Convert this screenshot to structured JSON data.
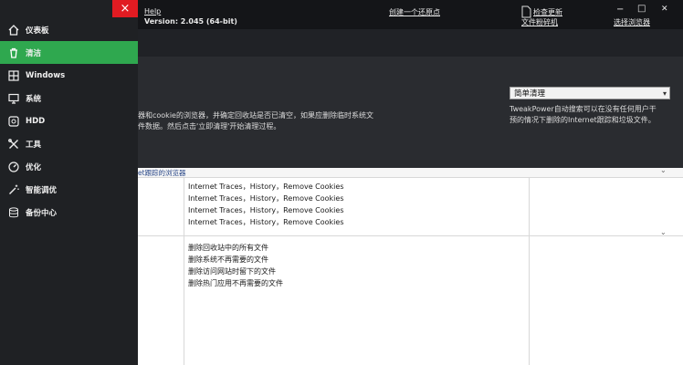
{
  "sidebar": {
    "close_label": "×",
    "items": [
      {
        "label": "仪表板",
        "icon": "home-icon"
      },
      {
        "label": "清洁",
        "icon": "trash-icon",
        "active": true
      },
      {
        "label": "Windows",
        "icon": "windows-icon"
      },
      {
        "label": "系统",
        "icon": "monitor-icon"
      },
      {
        "label": "HDD",
        "icon": "hdd-icon"
      },
      {
        "label": "工具",
        "icon": "tools-icon"
      },
      {
        "label": "优化",
        "icon": "speedometer-icon"
      },
      {
        "label": "智能调优",
        "icon": "wand-icon"
      },
      {
        "label": "备份中心",
        "icon": "database-icon"
      }
    ]
  },
  "topbar": {
    "help": "Help",
    "version": "Version: 2.045 (64-bit)",
    "create_restore": "创建一个还原点",
    "check_update": "检查更新",
    "file_crusher": "文件粉碎机",
    "select_browser": "选择浏览器",
    "minimize": "−",
    "maximize": "□",
    "close": "✕"
  },
  "panel": {
    "desc_line1": "器和cookie的浏览器，并确定回收站是否已清空，如果应删除临时系统文",
    "desc_line2": "件数据。然后点击'立即清理'开始清理过程。",
    "select_value": "简单清理",
    "select_help_line1": "TweakPower自动搜索可以在没有任何用户干",
    "select_help_line2": "预的情况下删除的Internet跟踪和垃圾文件。"
  },
  "list": {
    "section1_header": "et跟踪的浏览器",
    "section1_rows": [
      "Internet Traces，History，Remove Cookies",
      "Internet Traces，History，Remove Cookies",
      "Internet Traces，History，Remove Cookies",
      "Internet Traces，History，Remove Cookies"
    ],
    "section2_rows": [
      "删除回收站中的所有文件",
      "删除系统不再需要的文件",
      "删除访问网站时留下的文件",
      "删除热门应用不再需要的文件"
    ]
  },
  "colors": {
    "accent": "#2fa84f",
    "close_red": "#e11b22"
  }
}
